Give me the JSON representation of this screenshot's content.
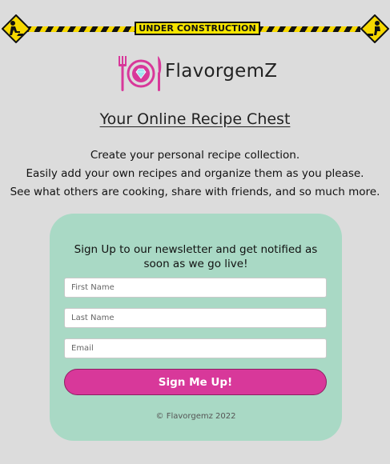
{
  "banner": {
    "label": "UNDER CONSTRUCTION"
  },
  "logo": {
    "text": "FlavorgemZ"
  },
  "hero": {
    "title": "Your Online Recipe Chest",
    "lines": [
      "Create your personal recipe collection.",
      "Easily add your own recipes and organize them as you please.",
      "See what others are cooking, share with friends, and so much more."
    ]
  },
  "signup": {
    "heading": "Sign Up to our newsletter and get notified as soon as we go live!",
    "first_name_placeholder": "First Name",
    "last_name_placeholder": "Last Name",
    "email_placeholder": "Email",
    "button_label": "Sign Me Up!",
    "footer": "© Flavorgemz 2022"
  },
  "colors": {
    "background": "#dcdcdc",
    "card": "#a9d9c5",
    "accent": "#d8389a",
    "construction_yellow": "#f6e500"
  },
  "icons": [
    "construction-worker-icon",
    "fork-plate-knife-diamond-logo"
  ]
}
